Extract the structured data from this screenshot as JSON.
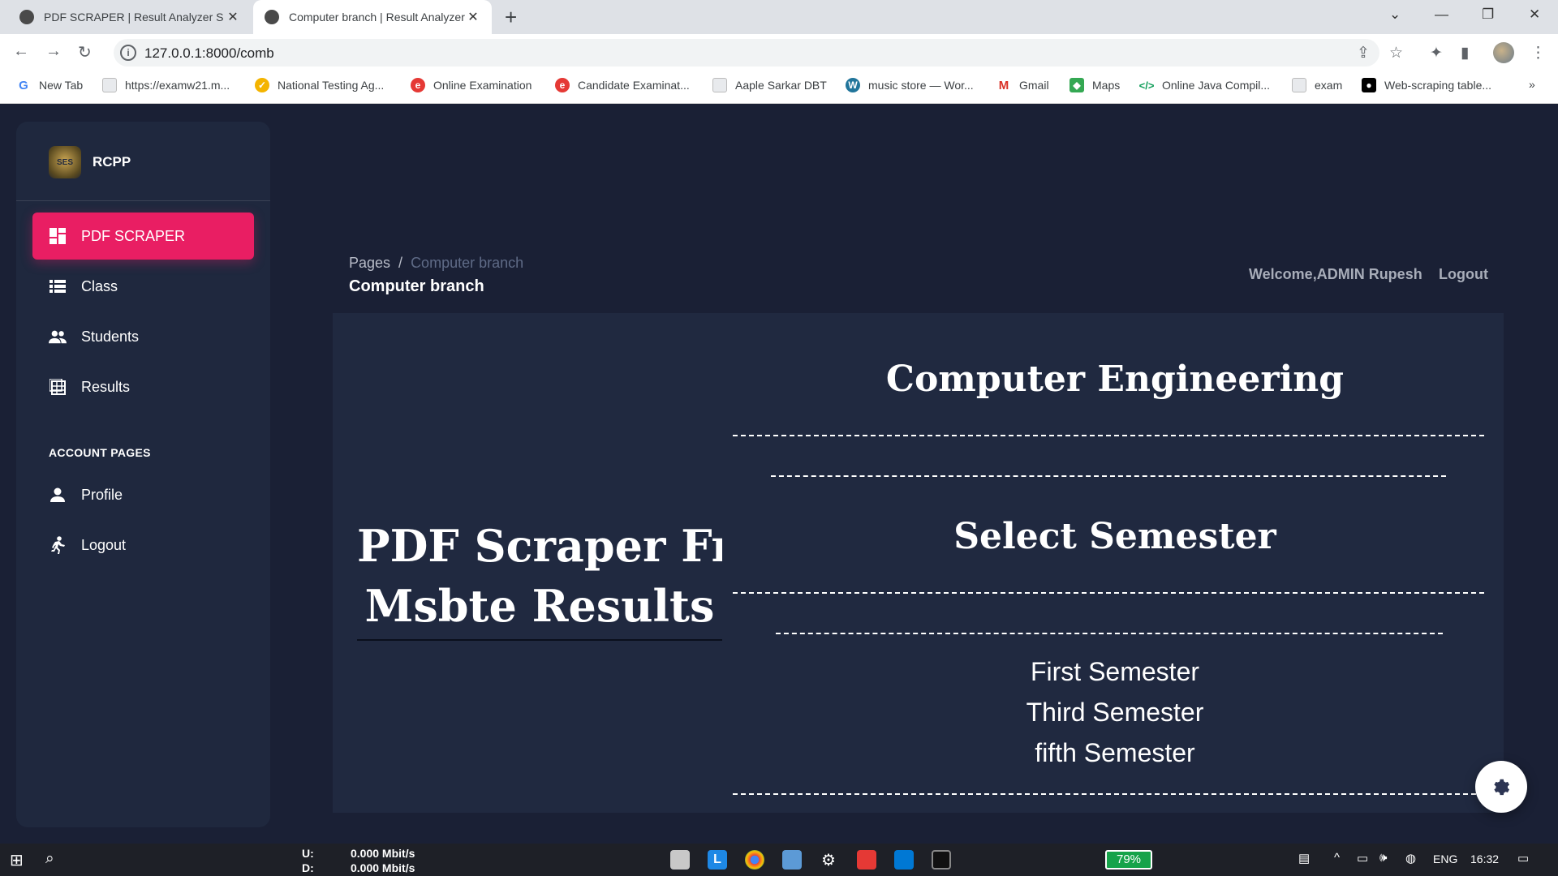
{
  "browser": {
    "tabs": [
      {
        "title": "PDF SCRAPER | Result Analyzer S",
        "active": false
      },
      {
        "title": "Computer branch | Result Analyzer",
        "active": true
      }
    ],
    "url": "127.0.0.1:8000/comb",
    "bookmarks": [
      {
        "label": "New Tab",
        "icon": "google-icon"
      },
      {
        "label": "https://examw21.m...",
        "icon": "page-icon"
      },
      {
        "label": "National Testing Ag...",
        "icon": "nta-icon"
      },
      {
        "label": "Online Examination",
        "icon": "exam-icon"
      },
      {
        "label": "Candidate Examinat...",
        "icon": "exam-icon"
      },
      {
        "label": "Aaple Sarkar DBT",
        "icon": "page-icon"
      },
      {
        "label": "music store — Wor...",
        "icon": "wordpress-icon"
      },
      {
        "label": "Gmail",
        "icon": "gmail-icon"
      },
      {
        "label": "Maps",
        "icon": "maps-icon"
      },
      {
        "label": "Online Java Compil...",
        "icon": "code-icon"
      },
      {
        "label": "exam",
        "icon": "page-icon"
      },
      {
        "label": "Web-scraping table...",
        "icon": "medium-icon"
      }
    ],
    "more_bookmarks": "»"
  },
  "sidebar": {
    "brand": "RCPP",
    "items": [
      {
        "label": "PDF SCRAPER",
        "icon": "dashboard-icon",
        "active": true
      },
      {
        "label": "Class",
        "icon": "list-icon",
        "active": false
      },
      {
        "label": "Students",
        "icon": "people-icon",
        "active": false
      },
      {
        "label": "Results",
        "icon": "table-icon",
        "active": false
      }
    ],
    "section_label": "ACCOUNT PAGES",
    "account_items": [
      {
        "label": "Profile",
        "icon": "person-icon"
      },
      {
        "label": "Logout",
        "icon": "running-icon"
      }
    ]
  },
  "header": {
    "breadcrumb_root": "Pages",
    "breadcrumb_separator": "/",
    "breadcrumb_current": "Computer branch",
    "page_title": "Computer branch",
    "welcome": "Welcome,ADMIN Rupesh",
    "logout": "Logout"
  },
  "content": {
    "hero_line1": "PDF Scraper Fro",
    "hero_line2": "Msbte Results",
    "department": "Computer Engineering",
    "select_heading": "Select Semester",
    "semesters": [
      "First Semester",
      "Third Semester",
      "fifth Semester"
    ]
  },
  "taskbar": {
    "upload_label": "U:",
    "download_label": "D:",
    "upload_speed": "0.000 Mbit/s",
    "download_speed": "0.000 Mbit/s",
    "battery": "79%",
    "language": "ENG",
    "time": "16:32"
  },
  "colors": {
    "accent": "#e91e63",
    "background": "#1a2035",
    "sidebar": "#1f283e",
    "card": "#202940"
  }
}
